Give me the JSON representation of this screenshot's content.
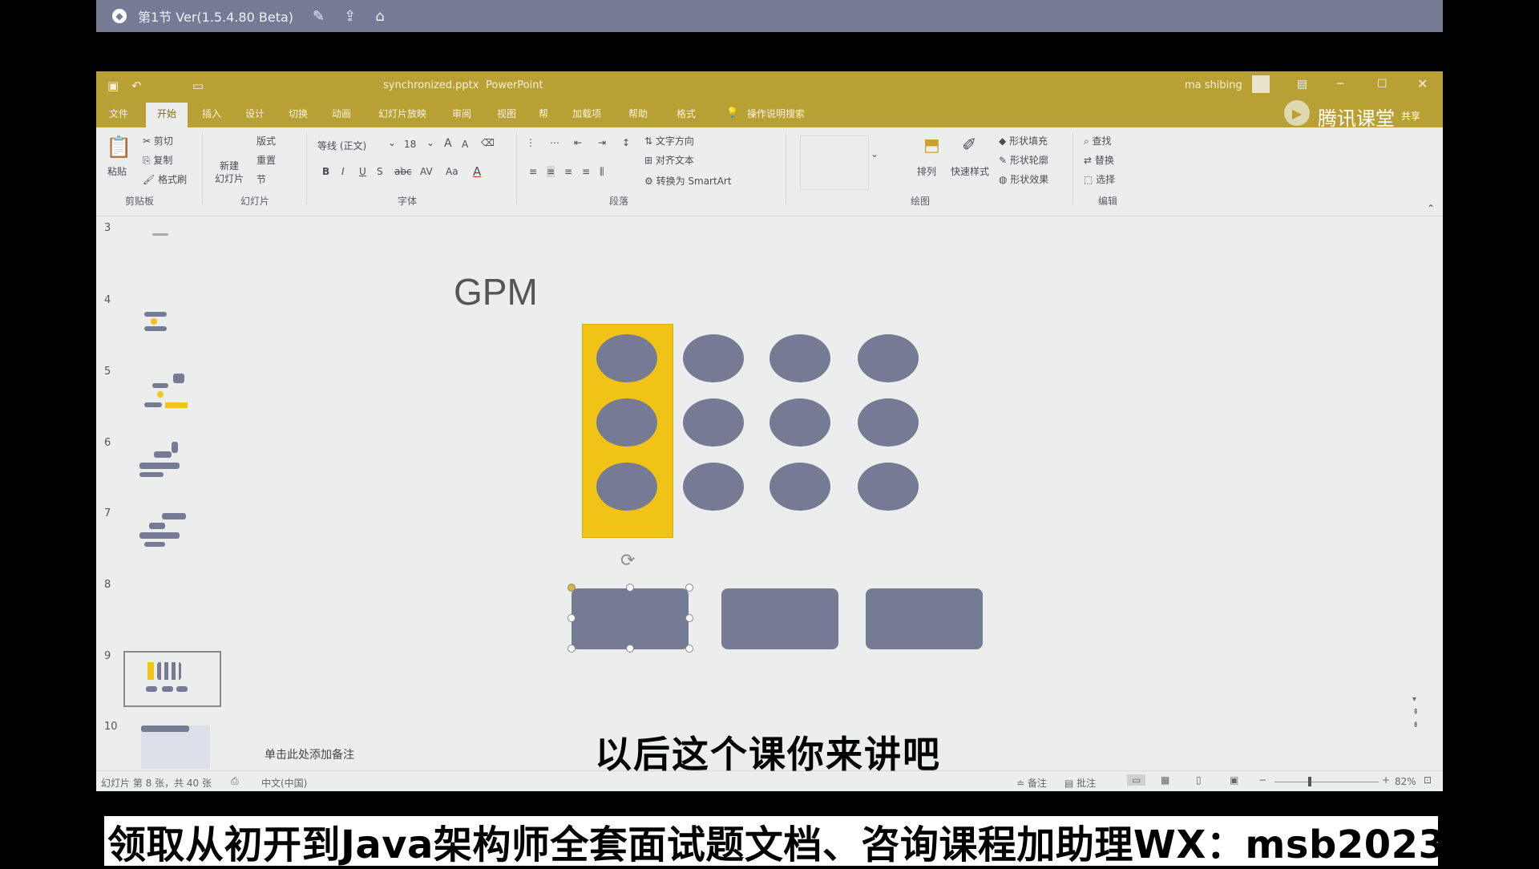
{
  "player": {
    "title": "第1节 Ver(1.5.4.80 Beta)",
    "icons": [
      "edit-icon",
      "share-icon",
      "home-icon"
    ]
  },
  "titlebar": {
    "filename": "synchronized.pptx",
    "app": "PowerPoint",
    "user": "ma shibing",
    "brand": "腾讯课堂",
    "share": "共享"
  },
  "tabs": [
    "文件",
    "开始",
    "插入",
    "设计",
    "切换",
    "动画",
    "幻灯片放映",
    "审阅",
    "视图",
    "帮",
    "加载项",
    "帮助",
    "格式"
  ],
  "active_tab": "开始",
  "tell_me": "操作说明搜索",
  "ribbon": {
    "paste": "粘贴",
    "cut": "剪切",
    "copy": "复制",
    "format_painter": "格式刷",
    "clipboard": "剪贴板",
    "new_slide": "新建\n幻灯片",
    "layout": "版式",
    "reset": "重置",
    "section": "节",
    "slides_group": "幻灯片",
    "font_name": "等线 (正文)",
    "font_size": "18",
    "font_group": "字体",
    "paragraph_group": "段落",
    "text_direction": "文字方向",
    "align_text": "对齐文本",
    "convert_smartart": "转换为 SmartArt",
    "arrange": "排列",
    "quick_styles": "快速样式",
    "shape_fill": "形状填充",
    "shape_outline": "形状轮廓",
    "shape_effects": "形状效果",
    "drawing_group": "绘图",
    "find": "查找",
    "replace": "替换",
    "select": "选择",
    "editing_group": "编辑"
  },
  "slide_numbers": [
    "3",
    "4",
    "5",
    "6",
    "7",
    "8",
    "9",
    "10"
  ],
  "slide": {
    "title": "GPM"
  },
  "notes_placeholder": "单击此处添加备注",
  "subtitle": "以后这个课你来讲吧",
  "status": {
    "slide_info": "幻灯片 第 8 张，共 40 张",
    "language": "中文(中国)",
    "notes": "备注",
    "comments": "批注",
    "zoom": "82%"
  },
  "banner": "领取从初开到Java架构师全套面试题文档、咨询课程加助理WX：msb2023",
  "colors": {
    "accent": "#b9a035",
    "shape": "#757b94",
    "highlight": "#f2c317"
  }
}
